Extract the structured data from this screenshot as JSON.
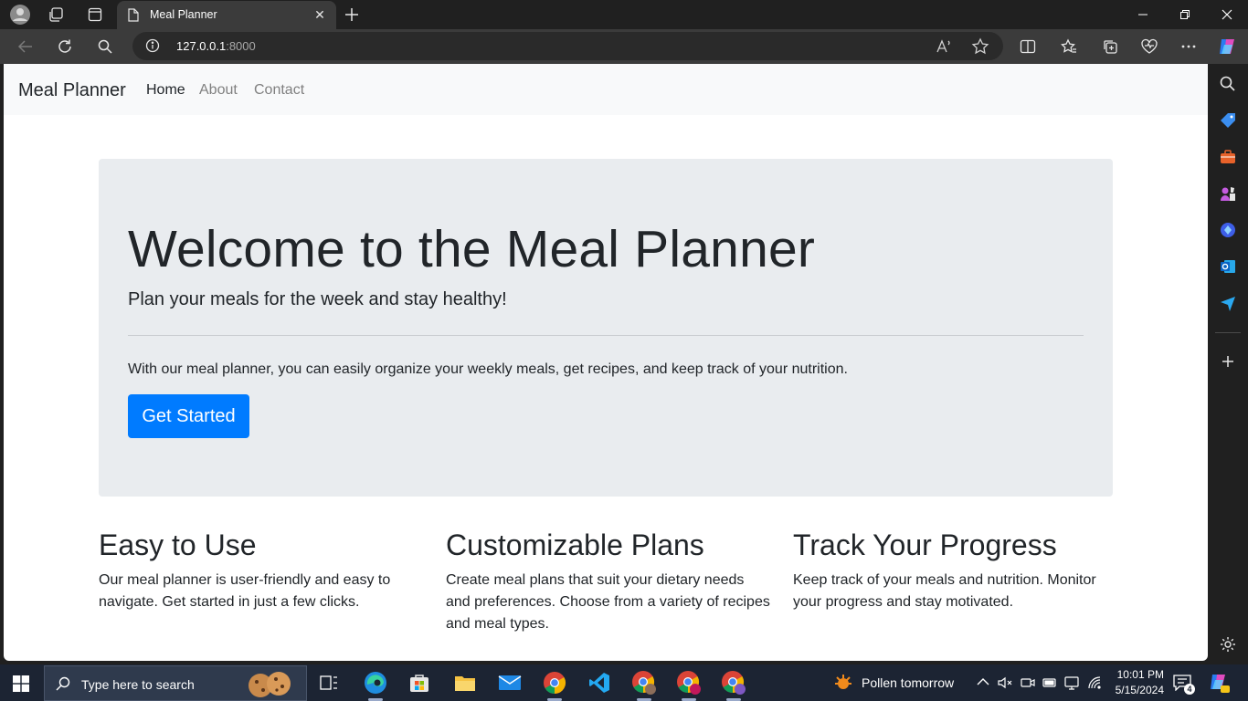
{
  "browser": {
    "tab_title": "Meal Planner",
    "url_host": "127.0.0.1",
    "url_port": ":8000"
  },
  "site": {
    "brand": "Meal Planner",
    "nav": [
      "Home",
      "About",
      "Contact"
    ]
  },
  "hero": {
    "title": "Welcome to the Meal Planner",
    "lead": "Plan your meals for the week and stay healthy!",
    "body": "With our meal planner, you can easily organize your weekly meals, get recipes, and keep track of your nutrition.",
    "button": "Get Started"
  },
  "features": [
    {
      "title": "Easy to Use",
      "text": "Our meal planner is user-friendly and easy to navigate. Get started in just a few clicks."
    },
    {
      "title": "Customizable Plans",
      "text": "Create meal plans that suit your dietary needs and preferences. Choose from a variety of recipes and meal types."
    },
    {
      "title": "Track Your Progress",
      "text": "Keep track of your meals and nutrition. Monitor your progress and stay motivated."
    }
  ],
  "taskbar": {
    "search_placeholder": "Type here to search",
    "weather": "Pollen tomorrow",
    "time": "10:01 PM",
    "date": "5/15/2024",
    "notification_count": "4"
  },
  "colors": {
    "primary": "#007bff",
    "jumbotron": "#e9ecef",
    "navbar": "#f8f9fa",
    "browser_chrome": "#202020",
    "taskbar": "#1c2433"
  }
}
